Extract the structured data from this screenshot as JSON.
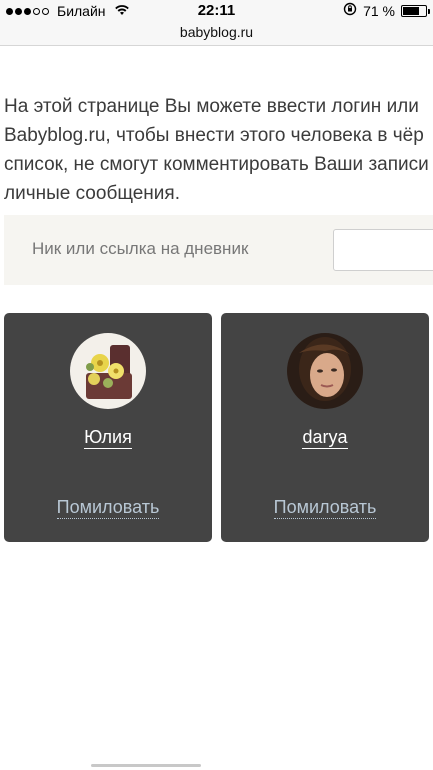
{
  "status_bar": {
    "carrier": "Билайн",
    "time": "22:11",
    "battery_percent_text": "71 %",
    "battery_level": 0.71,
    "icons": [
      "signal-dots",
      "wifi-icon",
      "rotation-lock-icon",
      "battery-icon"
    ]
  },
  "browser": {
    "url": "babyblog.ru"
  },
  "intro": {
    "lines": [
      "На этой странице Вы можете ввести логин или",
      "Babyblog.ru, чтобы внести этого человека в чёр",
      "список, не смогут комментировать Ваши записи",
      "личные сообщения."
    ]
  },
  "search": {
    "label": "Ник или ссылка на дневник",
    "value": ""
  },
  "users": [
    {
      "name": "Юлия",
      "action": "Помиловать",
      "avatar": "flowers-photo"
    },
    {
      "name": "darya",
      "action": "Помиловать",
      "avatar": "woman-portrait-photo"
    }
  ],
  "colors": {
    "card_bg": "#444444",
    "link_muted": "#b8c7d4",
    "panel_bg": "#f6f5f1"
  }
}
